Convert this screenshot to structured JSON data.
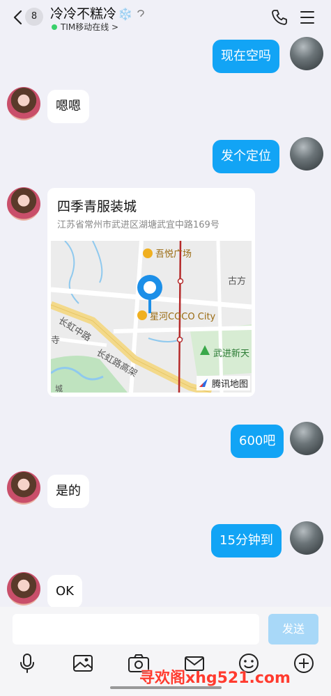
{
  "header": {
    "unread_count": "8",
    "title": "冷冷不糕冷",
    "title_emoji": "❄️",
    "status": "TIM移动在线 >",
    "back_icon": "chevron-left-icon",
    "phone_icon": "phone-icon",
    "menu_icon": "menu-icon"
  },
  "messages": [
    {
      "side": "out",
      "text": "现在空吗"
    },
    {
      "side": "in",
      "text": "嗯嗯"
    },
    {
      "side": "out",
      "text": "发个定位"
    },
    {
      "side": "in",
      "type": "location"
    },
    {
      "side": "out",
      "text": "600吧"
    },
    {
      "side": "in",
      "text": "是的"
    },
    {
      "side": "out",
      "text": "15分钟到"
    },
    {
      "side": "in",
      "text": "OK"
    }
  ],
  "location": {
    "name": "四季青服装城",
    "address": "江苏省常州市武进区湖塘武宜中路169号",
    "map_labels": {
      "poi_top": "吾悦广场",
      "poi_center": "星河COCO City",
      "poi_right_top": "古方",
      "poi_right": "武进新天",
      "road_1": "长虹中路",
      "road_2": "长虹路高架",
      "left_edge_1": "寺",
      "left_edge_2": "城"
    },
    "map_brand": "腾讯地图"
  },
  "input": {
    "placeholder": "",
    "send_label": "发送"
  },
  "toolbar": [
    "mic-icon",
    "image-icon",
    "camera-icon",
    "mail-icon",
    "emoji-icon",
    "plus-icon"
  ],
  "watermark": "寻欢阁xhg521.com",
  "colors": {
    "accent": "#12a4f5",
    "background": "#f0f0f7",
    "send_disabled": "#a8d8f8",
    "online": "#3ad06b"
  }
}
